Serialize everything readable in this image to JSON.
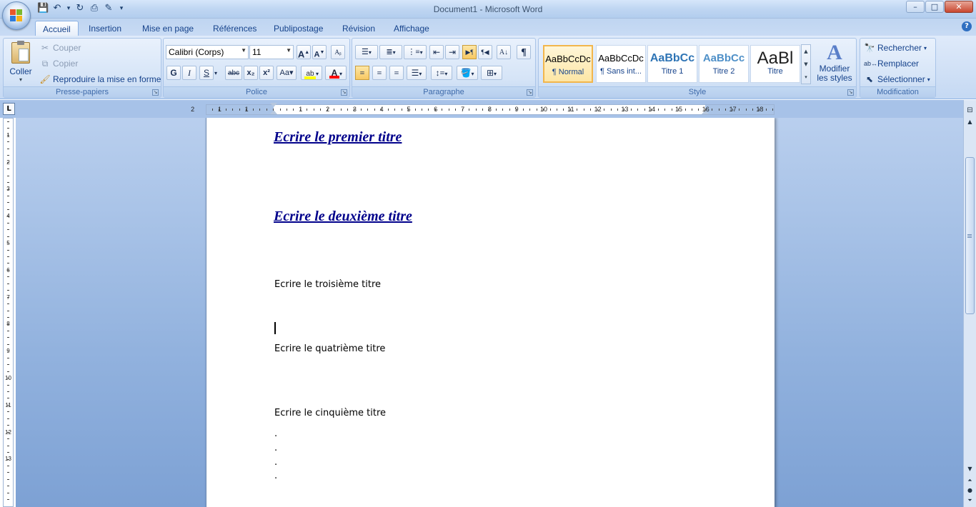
{
  "window": {
    "title": "Document1 - Microsoft Word",
    "minimize": "–",
    "maximize": "□",
    "close": "✕"
  },
  "quick_access": [
    {
      "name": "save-icon",
      "glyph": "💾"
    },
    {
      "name": "undo-icon",
      "glyph": "↶"
    },
    {
      "name": "undo-dropdown-icon",
      "glyph": "▾"
    },
    {
      "name": "redo-icon",
      "glyph": "↻"
    },
    {
      "name": "print-icon",
      "glyph": "⎙"
    },
    {
      "name": "format-painter-qat-icon",
      "glyph": "✎"
    },
    {
      "name": "customize-qat-icon",
      "glyph": "▾"
    }
  ],
  "tabs": [
    "Accueil",
    "Insertion",
    "Mise en page",
    "Références",
    "Publipostage",
    "Révision",
    "Affichage"
  ],
  "help": "?",
  "clipboard": {
    "paste": "Coller",
    "cut": "Couper",
    "copy": "Copier",
    "format_painter": "Reproduire la mise en forme",
    "label": "Presse-papiers"
  },
  "font": {
    "family": "Calibri (Corps)",
    "size": "11",
    "label": "Police",
    "bold": "G",
    "italic": "I",
    "underline": "S",
    "strike": "abc",
    "subscript": "x₂",
    "superscript": "x²",
    "change_case": "Aa"
  },
  "paragraph": {
    "label": "Paragraphe",
    "pilcrow": "¶"
  },
  "styles": {
    "label": "Style",
    "items": [
      {
        "sample": "AaBbCcDc",
        "name": "¶ Normal",
        "color": "#000000"
      },
      {
        "sample": "AaBbCcDc",
        "name": "¶ Sans int...",
        "color": "#000000"
      },
      {
        "sample": "AaBbCc",
        "name": "Titre 1",
        "color": "#2e74b5"
      },
      {
        "sample": "AaBbCc",
        "name": "Titre 2",
        "color": "#4f90c8"
      },
      {
        "sample": "AaBl",
        "name": "Titre",
        "color": "#1f1f1f"
      }
    ],
    "change_styles": "Modifier les styles"
  },
  "editing": {
    "find": "Rechercher",
    "replace": "Remplacer",
    "select": "Sélectionner",
    "label": "Modification"
  },
  "ruler": {
    "tab_selector": "L",
    "h_numbers": [
      "2",
      "1",
      "1",
      "1",
      "2",
      "3",
      "4",
      "5",
      "6",
      "7",
      "8",
      "9",
      "10",
      "11",
      "12",
      "13",
      "14",
      "15",
      "16",
      "17",
      "18"
    ],
    "v_numbers": [
      "1",
      "2",
      "3",
      "4",
      "5",
      "6",
      "7",
      "8",
      "9",
      "10",
      "11",
      "12",
      "13"
    ]
  },
  "document": {
    "heading1": "Ecrire le premier titre",
    "heading2": "Ecrire le deuxième titre",
    "line3": "Ecrire le troisième titre",
    "line4": "Ecrire le quatrième titre",
    "line5": "Ecrire le cinquième titre",
    "dots": [
      ".",
      ".",
      ".",
      "."
    ]
  },
  "colors": {
    "heading": "#00008b",
    "highlight": "#ffff00",
    "font_color": "#ff0000"
  }
}
